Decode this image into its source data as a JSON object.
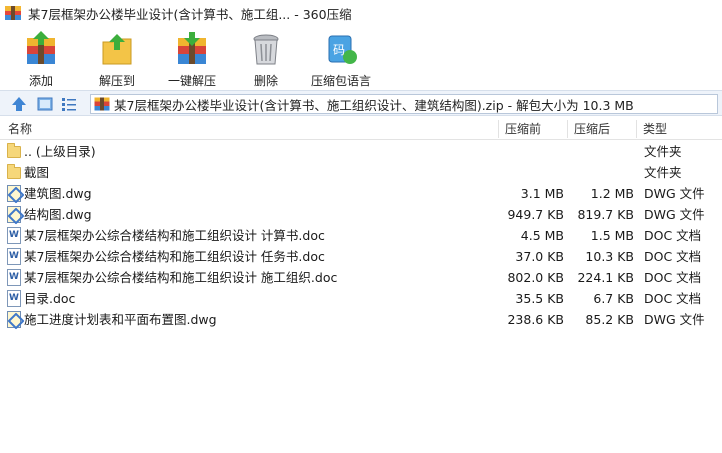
{
  "window": {
    "title": "某7层框架办公楼毕业设计(含计算书、施工组... - 360压缩"
  },
  "toolbar": {
    "add_label": "添加",
    "extract_to_label": "解压到",
    "one_click_label": "一键解压",
    "delete_label": "删除",
    "encoding_label": "压缩包语言"
  },
  "address": {
    "path": "某7层框架办公楼毕业设计(含计算书、施工组织设计、建筑结构图).zip - 解包大小为 10.3 MB"
  },
  "columns": {
    "name": "名称",
    "original_size": "压缩前",
    "compressed_size": "压缩后",
    "type": "类型"
  },
  "files": [
    {
      "icon": "folder-up-icon",
      "name": ".. (上级目录)",
      "size": "",
      "compressed": "",
      "type": "文件夹"
    },
    {
      "icon": "folder-icon",
      "name": "截图",
      "size": "",
      "compressed": "",
      "type": "文件夹"
    },
    {
      "icon": "dwg-file-icon",
      "name": "建筑图.dwg",
      "size": "3.1 MB",
      "compressed": "1.2 MB",
      "type": "DWG 文件"
    },
    {
      "icon": "dwg-file-icon",
      "name": "结构图.dwg",
      "size": "949.7 KB",
      "compressed": "819.7 KB",
      "type": "DWG 文件"
    },
    {
      "icon": "doc-file-icon",
      "name": "某7层框架办公综合楼结构和施工组织设计 计算书.doc",
      "size": "4.5 MB",
      "compressed": "1.5 MB",
      "type": "DOC 文档"
    },
    {
      "icon": "doc-file-icon",
      "name": "某7层框架办公综合楼结构和施工组织设计 任务书.doc",
      "size": "37.0 KB",
      "compressed": "10.3 KB",
      "type": "DOC 文档"
    },
    {
      "icon": "doc-file-icon",
      "name": "某7层框架办公综合楼结构和施工组织设计 施工组织.doc",
      "size": "802.0 KB",
      "compressed": "224.1 KB",
      "type": "DOC 文档"
    },
    {
      "icon": "doc-file-icon",
      "name": "目录.doc",
      "size": "35.5 KB",
      "compressed": "6.7 KB",
      "type": "DOC 文档"
    },
    {
      "icon": "dwg-file-icon",
      "name": "施工进度计划表和平面布置图.dwg",
      "size": "238.6 KB",
      "compressed": "85.2 KB",
      "type": "DWG 文件"
    }
  ]
}
